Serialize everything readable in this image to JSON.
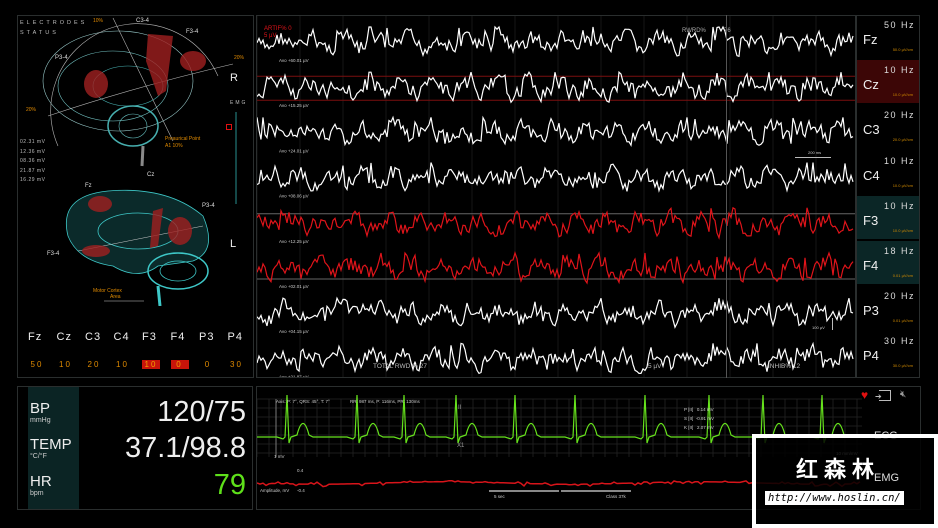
{
  "brain_panel": {
    "title_line1": "ELECTRODES",
    "title_line2": "STATUS",
    "top_labels": {
      "c34": "C3-4",
      "f34": "F3-4",
      "p34": "P3-4",
      "pct_top": "10%",
      "pct_right": "20%",
      "pct_left": "20%",
      "side": "R",
      "preauricular": "Preaurical Point",
      "a1": "A1  10%"
    },
    "readouts": [
      "02.31 mV",
      "12.36 mV",
      "08.36 mV",
      "21.87 mV",
      "16.29 mV"
    ],
    "emg_label": "EMG",
    "bottom_labels": {
      "fz": "Fz",
      "cz": "Cz",
      "p34": "P3-4",
      "f34": "F3-4",
      "side": "L",
      "motor1": "Motor Cortex",
      "motor2": "Area"
    },
    "electrodes": [
      {
        "name": "Fz",
        "value": "50",
        "alert": false
      },
      {
        "name": "Cz",
        "value": "10",
        "alert": false
      },
      {
        "name": "C3",
        "value": "20",
        "alert": false
      },
      {
        "name": "C4",
        "value": "10",
        "alert": false
      },
      {
        "name": "F3",
        "value": "10",
        "alert": true
      },
      {
        "name": "F4",
        "value": "0",
        "alert": true
      },
      {
        "name": "P3",
        "value": "0",
        "alert": false
      },
      {
        "name": "P4",
        "value": "30",
        "alert": false
      }
    ]
  },
  "eeg": {
    "artif": "ARTIF% 0",
    "artif_unit": "5 µV",
    "rwrd_label": "RWRD%",
    "rwrd_value": "76",
    "scale_time": "200 ms",
    "scale_amp": "100 µV",
    "total_rwd": "TOTAL RWD  % 27",
    "unit": "5 µV",
    "inhib": "INHIB% 12",
    "channels": [
      {
        "name": "Fz",
        "hz": "50 Hz",
        "sens": "50.0 µV/cm",
        "avg": "Avo +60.01 µV",
        "color": "#ffffff",
        "bg": ""
      },
      {
        "name": "Cz",
        "hz": "10 Hz",
        "sens": "10.0 µV/cm",
        "avg": "Avo +15.25 µV",
        "color": "#ffffff",
        "bg": "#3c0606"
      },
      {
        "name": "C3",
        "hz": "20 Hz",
        "sens": "20.0 µV/cm",
        "avg": "Avo +24.01 µV",
        "color": "#ffffff",
        "bg": ""
      },
      {
        "name": "C4",
        "hz": "10 Hz",
        "sens": "10.0 µV/cm",
        "avg": "Avo +08.06 µV",
        "color": "#ffffff",
        "bg": ""
      },
      {
        "name": "F3",
        "hz": "10 Hz",
        "sens": "10.0 µV/cm",
        "avg": "Avo +12.25 µV",
        "color": "#e0141a",
        "bg": "#0b2626"
      },
      {
        "name": "F4",
        "hz": "18 Hz",
        "sens": "0.01 µV/cm",
        "avg": "Avo +02.01 µV",
        "color": "#e0141a",
        "bg": "#0b2626"
      },
      {
        "name": "P3",
        "hz": "20 Hz",
        "sens": "0.01 µV/cm",
        "avg": "Avo +04.15 µV",
        "color": "#ffffff",
        "bg": ""
      },
      {
        "name": "P4",
        "hz": "30 Hz",
        "sens": "30.0 µV/cm",
        "avg": "Avo +21.87 µV",
        "color": "#ffffff",
        "bg": ""
      }
    ]
  },
  "vitals": {
    "bp_label": "BP",
    "bp_unit": "mmHg",
    "bp_value": "120/75",
    "temp_label": "TEMP",
    "temp_unit": "°C/°F",
    "temp_value": "37.1/98.8",
    "hr_label": "HR",
    "hr_unit": "bpm",
    "hr_value": "79"
  },
  "ecg": {
    "axis": "Axis: P: 7°, QRS: 45°, T: 7°",
    "intervals": "RR: 987 ms, P: 116ms, PR: 130ms",
    "lead": "II",
    "gain": "X1",
    "mv": "1 mV",
    "measures": [
      "P [II]   0.14 mV",
      "S [II]  -0.91 mV",
      "K [II]   2.07 mV"
    ],
    "scale": "10 mm/mV",
    "emg_top": "0.4",
    "emg_bottom": "-0.4",
    "amplitude": "Amplitude, mV",
    "time_scale": "5 sec",
    "class": "Class 37k",
    "ecg_label": "ECG",
    "emg_label": "EMG",
    "colors": {
      "ecg": "#66e21c",
      "emg": "#d8141a"
    }
  },
  "watermark": {
    "brand": "红森林",
    "url": "http://www.hoslin.cn/"
  }
}
